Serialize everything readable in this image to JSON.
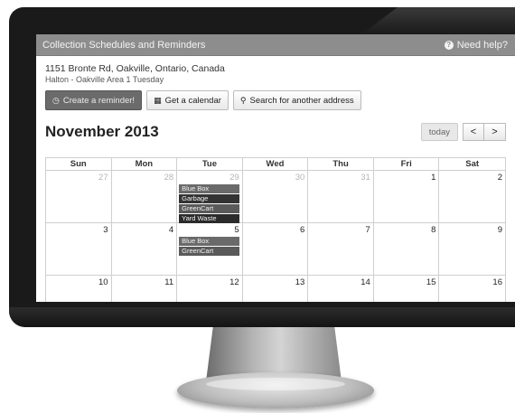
{
  "header": {
    "title": "Collection Schedules and Reminders",
    "help_label": "Need help?",
    "help_icon": "question-circle-icon"
  },
  "location": {
    "address": "1151 Bronte Rd, Oakville, Ontario, Canada",
    "area": "Halton - Oakville Area 1 Tuesday"
  },
  "actions": {
    "reminder_label": "Create a reminder!",
    "calendar_label": "Get a calendar",
    "search_label": "Search for another address"
  },
  "calendar": {
    "month_title": "November 2013",
    "today_label": "today",
    "prev_label": "<",
    "next_label": ">",
    "weekdays": [
      "Sun",
      "Mon",
      "Tue",
      "Wed",
      "Thu",
      "Fri",
      "Sat"
    ],
    "weeks": [
      {
        "days": [
          {
            "num": "27",
            "muted": true,
            "events": []
          },
          {
            "num": "28",
            "muted": true,
            "events": []
          },
          {
            "num": "29",
            "muted": true,
            "events": [
              "Blue Box",
              "Garbage",
              "GreenCart",
              "Yard Waste"
            ]
          },
          {
            "num": "30",
            "muted": true,
            "events": []
          },
          {
            "num": "31",
            "muted": true,
            "events": []
          },
          {
            "num": "1",
            "muted": false,
            "events": []
          },
          {
            "num": "2",
            "muted": false,
            "events": []
          }
        ]
      },
      {
        "days": [
          {
            "num": "3",
            "muted": false,
            "events": []
          },
          {
            "num": "4",
            "muted": false,
            "events": []
          },
          {
            "num": "5",
            "muted": false,
            "events": [
              "Blue Box",
              "GreenCart"
            ]
          },
          {
            "num": "6",
            "muted": false,
            "events": []
          },
          {
            "num": "7",
            "muted": false,
            "events": []
          },
          {
            "num": "8",
            "muted": false,
            "events": []
          },
          {
            "num": "9",
            "muted": false,
            "events": []
          }
        ]
      },
      {
        "days": [
          {
            "num": "10",
            "muted": false,
            "events": []
          },
          {
            "num": "11",
            "muted": false,
            "events": []
          },
          {
            "num": "12",
            "muted": false,
            "events": []
          },
          {
            "num": "13",
            "muted": false,
            "events": []
          },
          {
            "num": "14",
            "muted": false,
            "events": []
          },
          {
            "num": "15",
            "muted": false,
            "events": []
          },
          {
            "num": "16",
            "muted": false,
            "events": []
          }
        ]
      }
    ]
  },
  "colors": {
    "header_bar": "#8d8d8d",
    "primary_button": "#6b6b6b",
    "bezel": "#1a1a1a"
  }
}
